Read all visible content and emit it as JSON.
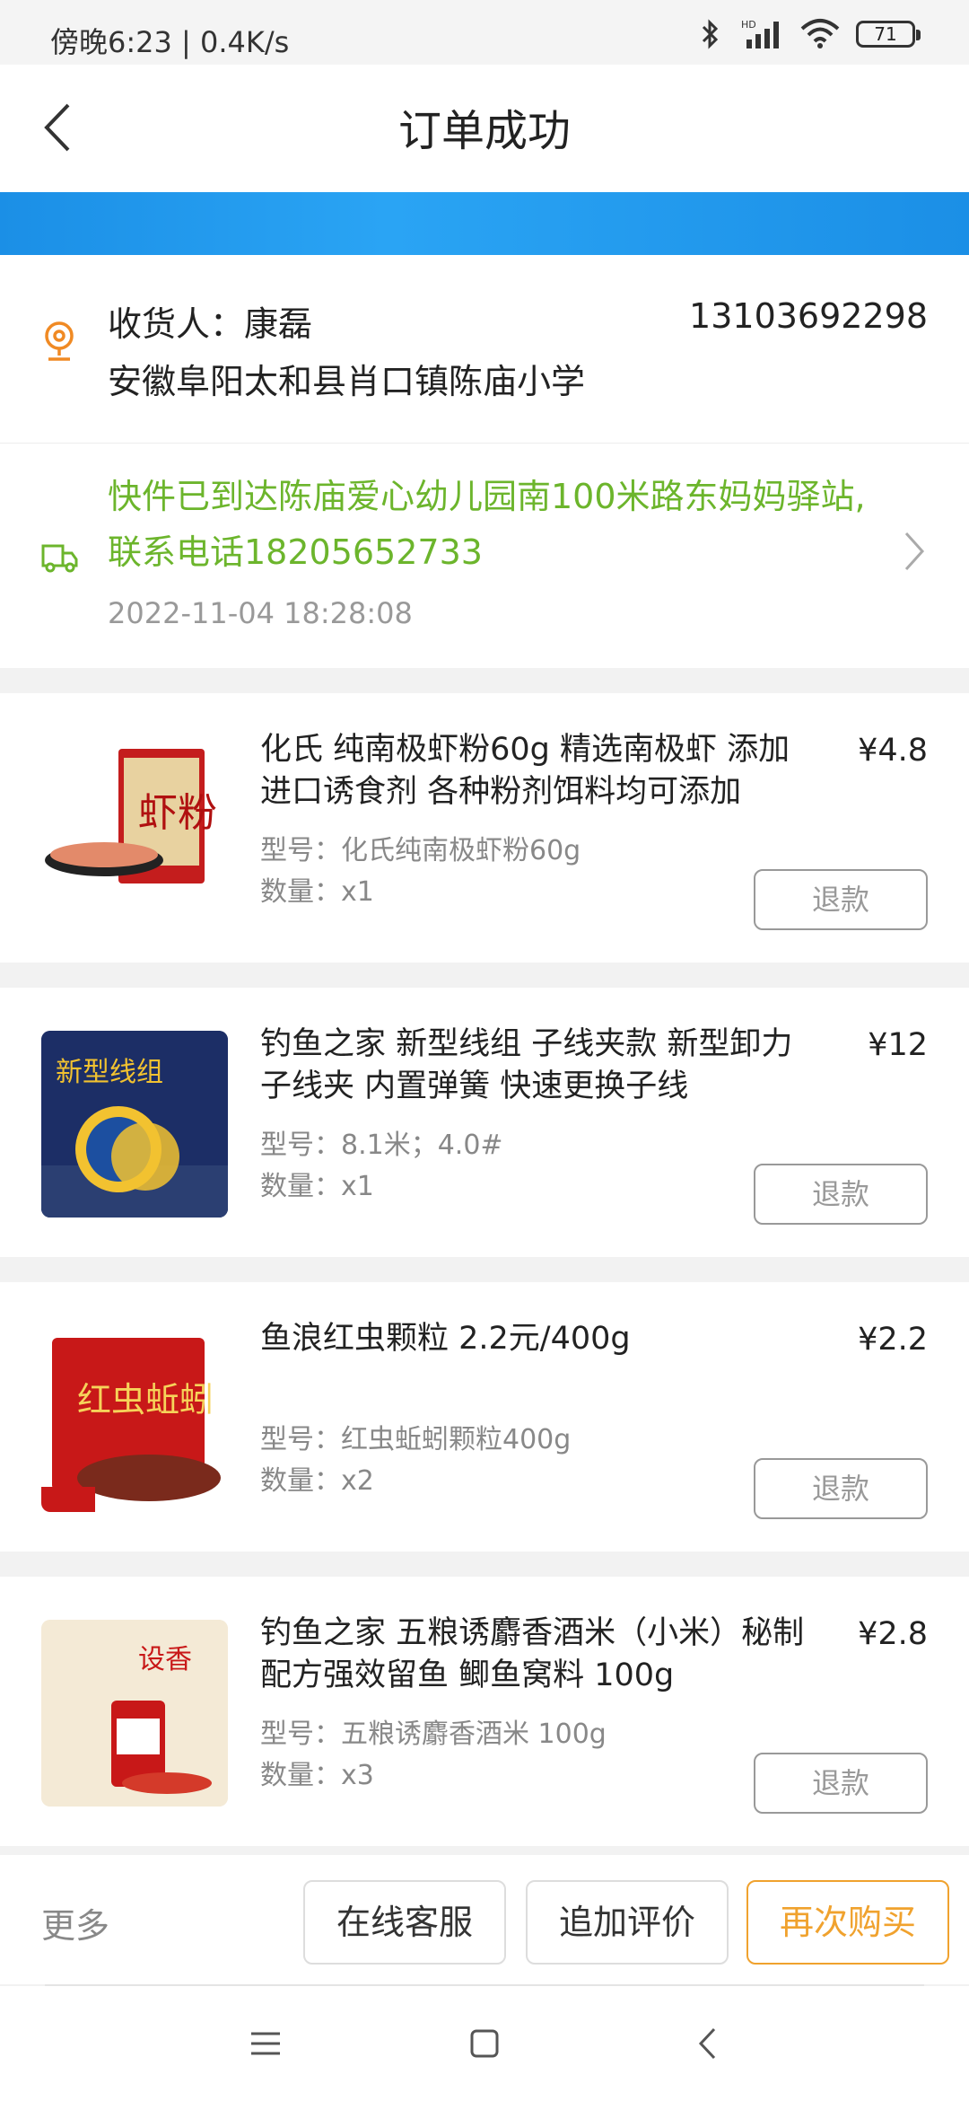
{
  "status_bar": {
    "time": "傍晚6:23 | 0.4K/s",
    "battery": "71",
    "icons": [
      "bluetooth-icon",
      "hd-signal-icon",
      "wifi-icon",
      "battery-icon"
    ]
  },
  "header": {
    "title": "订单成功",
    "back_icon": "chevron-left-icon"
  },
  "address": {
    "receiver": "收货人：康磊",
    "phone": "13103692298",
    "address": "安徽阜阳太和县肖口镇陈庙小学",
    "icon": "location-pin-icon"
  },
  "logistics": {
    "text": "快件已到达陈庙爱心幼儿园南100米路东妈妈驿站,联系电话18205652733",
    "time": "2022-11-04 18:28:08",
    "icon": "truck-icon",
    "color": "#6cb52c"
  },
  "products": [
    {
      "name": "化氏 纯南极虾粉60g 精选南极虾 添加进口诱食剂 各种粉剂饵料均可添加",
      "price": "¥4.8",
      "spec": "型号：化氏纯南极虾粉60g",
      "qty": "数量：x1",
      "refund": "退款",
      "thumb_text": "虾粉"
    },
    {
      "name": "钓鱼之家 新型线组 子线夹款 新型卸力子线夹 内置弹簧 快速更换子线",
      "price": "¥12",
      "spec": "型号：8.1米；4.0#",
      "qty": "数量：x1",
      "refund": "退款",
      "thumb_text": "新型线组"
    },
    {
      "name": "鱼浪红虫颗粒 2.2元/400g",
      "price": "¥2.2",
      "spec": "型号：红虫蚯蚓颗粒400g",
      "qty": "数量：x2",
      "refund": "退款",
      "thumb_text": "红虫蚯蚓"
    },
    {
      "name": "钓鱼之家 五粮诱麝香酒米（小米）秘制配方强效留鱼 鲫鱼窝料 100g",
      "price": "¥2.8",
      "spec": "型号：五粮诱麝香酒米 100g",
      "qty": "数量：x3",
      "refund": "退款",
      "thumb_text": "设香"
    }
  ],
  "actions": {
    "more": "更多",
    "service": "在线客服",
    "review": "追加评价",
    "rebuy": "再次购买",
    "accent": "#f0a22e"
  },
  "navbar": {
    "icons": [
      "menu-icon",
      "home-square-icon",
      "back-icon"
    ]
  }
}
